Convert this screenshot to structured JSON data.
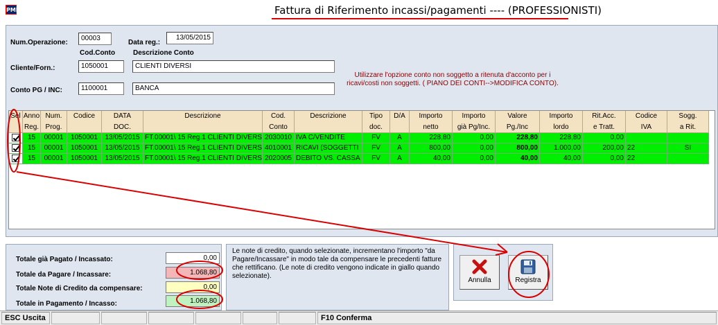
{
  "window": {
    "app_icon_text": "PMI",
    "title": "Fattura di Riferimento incassi/pagamenti ---- (PROFESSIONISTI)"
  },
  "form": {
    "num_operazione_label": "Num.Operazione:",
    "num_operazione_value": "00003",
    "data_reg_label": "Data reg.:",
    "data_reg_value": "13/05/2015",
    "cod_conto_label": "Cod.Conto",
    "descrizione_conto_label": "Descrizione Conto",
    "cliente_label": "Cliente/Forn.:",
    "cliente_code": "1050001",
    "cliente_desc": "CLIENTI DIVERSI",
    "conto_label": "Conto PG / INC:",
    "conto_code": "1100001",
    "conto_desc": "BANCA",
    "note": "Utilizzare l'opzione conto non soggetto a ritenuta d'acconto per i ricavi/costi non soggetti. ( PIANO DEI CONTI-->MODIFICA CONTO)."
  },
  "grid": {
    "headers": [
      [
        "Sel",
        ""
      ],
      [
        "Anno",
        "Reg."
      ],
      [
        "Num.",
        "Prog."
      ],
      [
        "Codice",
        ""
      ],
      [
        "DATA",
        "DOC."
      ],
      [
        "Descrizione",
        ""
      ],
      [
        "Cod.",
        "Conto"
      ],
      [
        "Descrizione",
        ""
      ],
      [
        "Tipo",
        "doc."
      ],
      [
        "D/A",
        ""
      ],
      [
        "Importo",
        "netto"
      ],
      [
        "Importo",
        "già Pg/Inc."
      ],
      [
        "Valore",
        "Pg./Inc"
      ],
      [
        "Importo",
        "lordo"
      ],
      [
        "Rit.Acc.",
        "e Tratt."
      ],
      [
        "Codice",
        "IVA"
      ],
      [
        "Sogg.",
        "a Rit."
      ]
    ],
    "rows": [
      [
        "",
        "15",
        "00001",
        "1050001",
        "13/05/2015",
        "FT.00001\\ 15    Reg.1 CLIENTI DIVERSI",
        "2030010",
        "IVA C/VENDITE",
        "FV",
        "A",
        "228,80",
        "0,00",
        "228,80",
        "228,80",
        "0,00",
        "",
        ""
      ],
      [
        "",
        "15",
        "00001",
        "1050001",
        "13/05/2015",
        "FT.00001\\ 15    Reg.1 CLIENTI DIVERSI",
        "4010001",
        "RICAVI (SOGGETTI",
        "FV",
        "A",
        "800,00",
        "0,00",
        "800,00",
        "1.000,00",
        "200,00",
        "22",
        "SI"
      ],
      [
        "",
        "15",
        "00001",
        "1050001",
        "13/05/2015",
        "FT.00001\\ 15    Reg.1 CLIENTI DIVERSI",
        "2020005",
        "DEBITO VS. CASSA",
        "FV",
        "A",
        "40,00",
        "0,00",
        "40,00",
        "40,00",
        "0,00",
        "22",
        ""
      ]
    ]
  },
  "totals": {
    "pagato_label": "Totale già Pagato / Incassato:",
    "pagato_value": "0,00",
    "da_pagare_label": "Totale da Pagare / Incassare:",
    "da_pagare_value": "1.068,80",
    "note_credito_label": "Totale Note di Credito da compensare:",
    "note_credito_value": "0,00",
    "in_pagamento_label": "Totale in Pagamento / Incasso:",
    "in_pagamento_value": "1.068,80"
  },
  "info": {
    "text": "Le note di credito, quando selezionate, incrementano l'importo \"da Pagare/Incassare\" in modo tale da compensare le precedenti fatture che rettificano. (Le note di credito vengono indicate in giallo quando selezionate)."
  },
  "buttons": {
    "annulla": "Annulla",
    "registra": "Registra"
  },
  "status": {
    "esc": "ESC Uscita",
    "f10": "F10 Conferma"
  },
  "colors": {
    "row_green": "#00ee00",
    "header_bg": "#f4e3c3",
    "da_pagare_bg": "#f4b6b6",
    "note_credito_bg": "#ffffc0",
    "in_pagamento_bg": "#bff2bf",
    "annotation_red": "#d80000"
  }
}
